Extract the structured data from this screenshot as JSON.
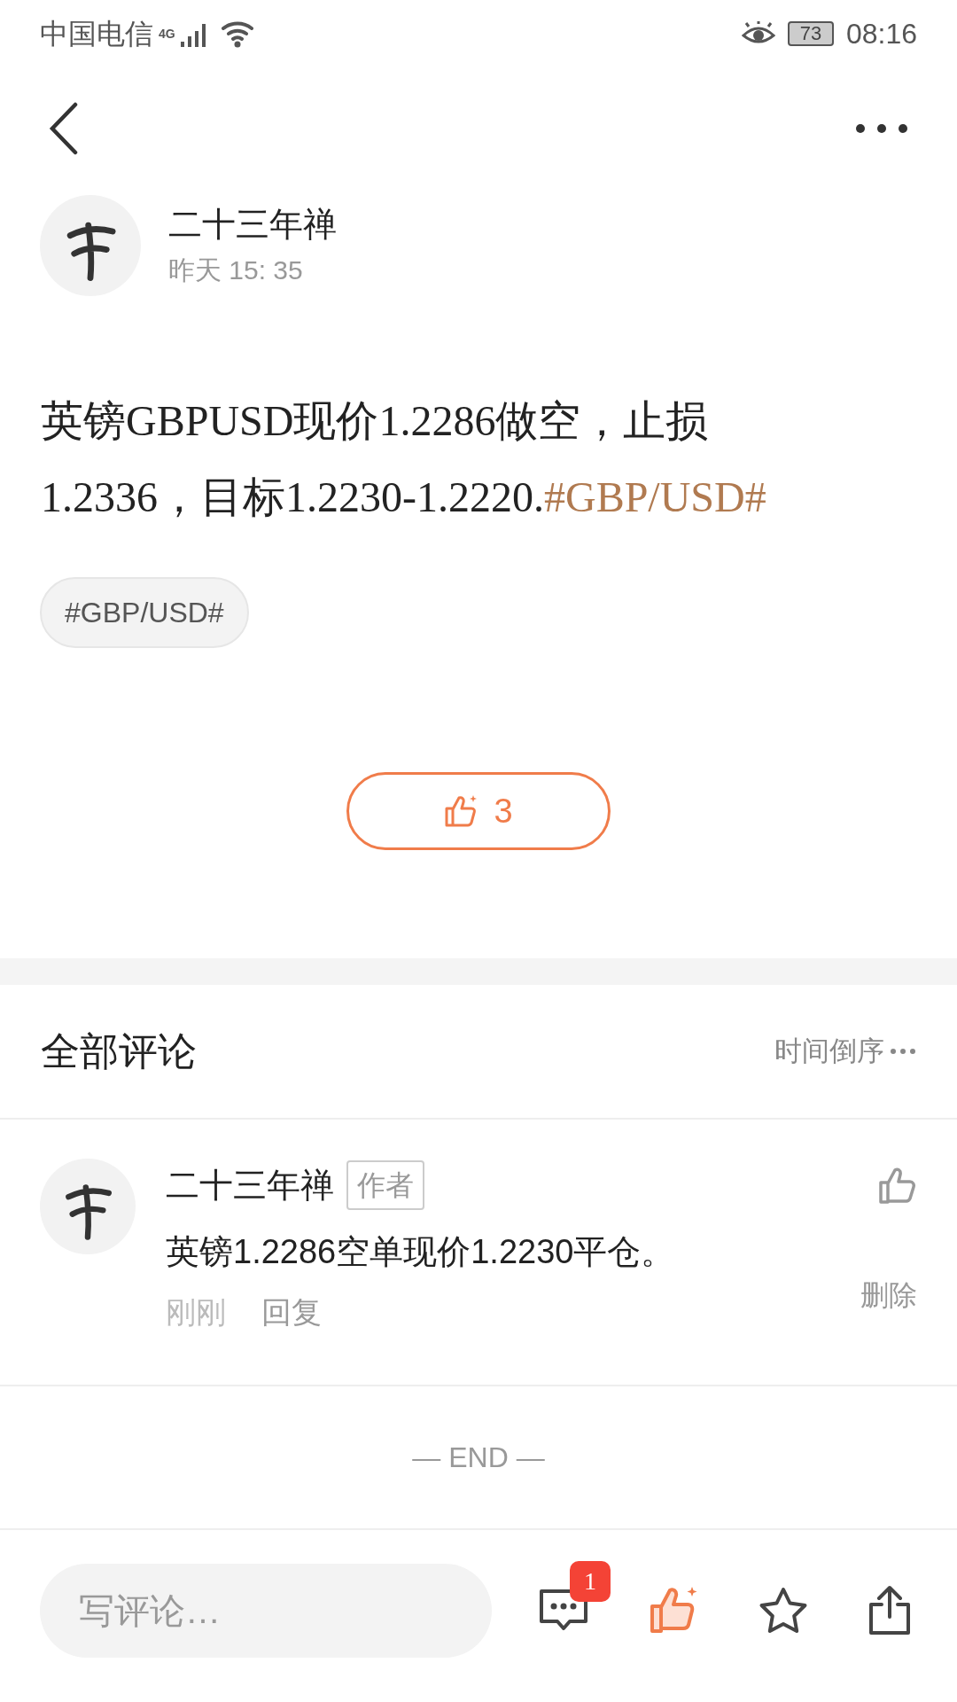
{
  "status_bar": {
    "carrier": "中国电信",
    "network": "4G",
    "battery": "73",
    "time": "08:16"
  },
  "post": {
    "author": "二十三年禅",
    "time": "昨天 15: 35",
    "text": "英镑GBPUSD现价1.2286做空，止损1.2336，目标1.2230-1.2220.",
    "text_link": "#GBP/USD#",
    "tags": [
      "#GBP/USD#"
    ],
    "likes": "3"
  },
  "comments_header": {
    "title": "全部评论",
    "sort": "时间倒序"
  },
  "comments": [
    {
      "author": "二十三年禅",
      "badge": "作者",
      "text": "英镑1.2286空单现价1.2230平仓。",
      "time": "刚刚",
      "reply": "回复",
      "delete": "删除"
    }
  ],
  "end_label": "— END —",
  "bottom_bar": {
    "placeholder": "写评论…",
    "comment_count": "1"
  }
}
